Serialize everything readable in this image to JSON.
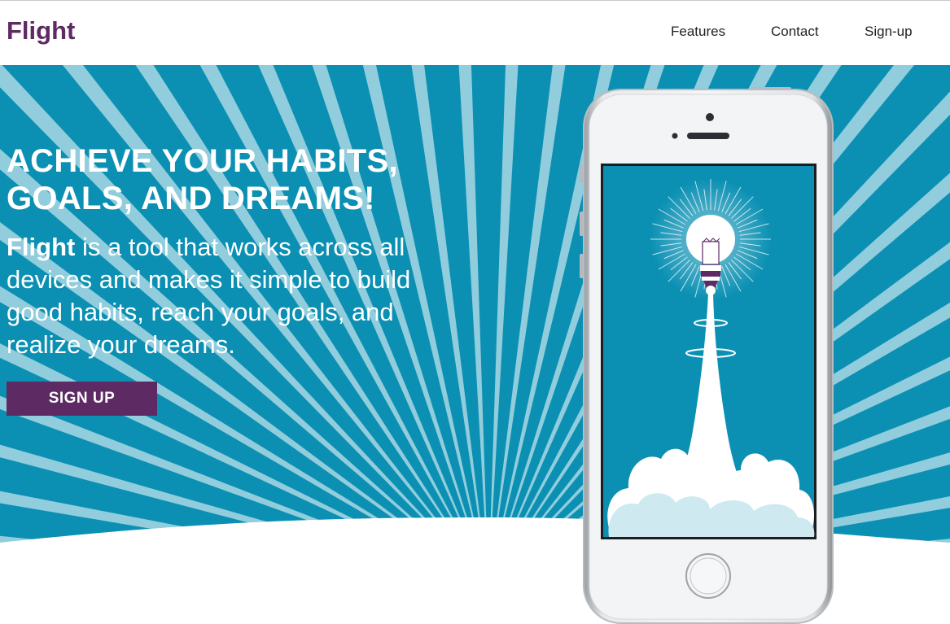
{
  "brand": {
    "name": "Flight"
  },
  "nav": {
    "features": "Features",
    "contact": "Contact",
    "signup": "Sign-up"
  },
  "hero": {
    "title_line1": "ACHIEVE YOUR HABITS,",
    "title_line2": "GOALS, AND DREAMS!",
    "desc_brand": "Flight",
    "desc_text": " is a tool that works across all devices and makes it simple to build good habits, reach your goals, and realize your dreams.",
    "cta_label": "SIGN UP"
  },
  "colors": {
    "brand_purple": "#5d2a63",
    "hero_blue": "#0b90b3",
    "nav_text": "#222222",
    "white": "#ffffff"
  },
  "icons": {
    "phone_illustration": "lightbulb-rocket-launch-illustration"
  }
}
